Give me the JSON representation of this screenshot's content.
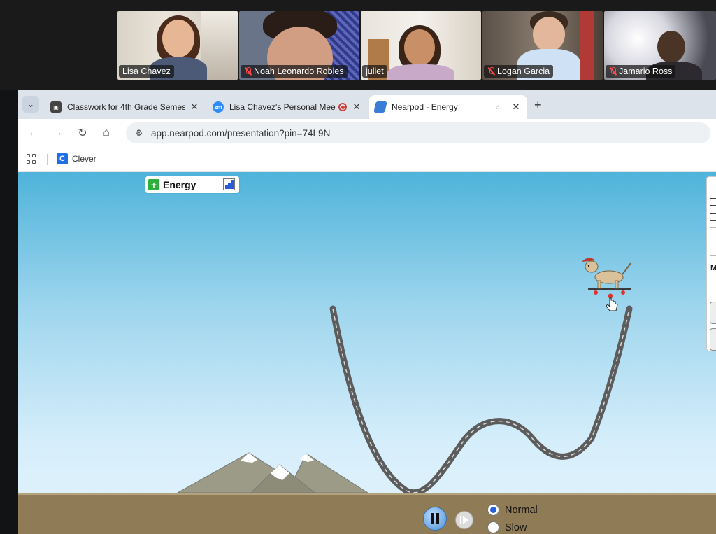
{
  "zoom": {
    "participants": [
      {
        "name": "Lisa Chavez",
        "muted": false,
        "active": false
      },
      {
        "name": "Noah Leonardo Robles",
        "muted": true,
        "active": false
      },
      {
        "name": "juliet",
        "muted": false,
        "active": true
      },
      {
        "name": "Logan Garcia",
        "muted": true,
        "active": false
      },
      {
        "name": "Jamario Ross",
        "muted": true,
        "active": false
      }
    ]
  },
  "browser": {
    "tabs": [
      {
        "title": "Classwork for 4th Grade Semes",
        "favicon": "classroom-icon"
      },
      {
        "title": "Lisa Chavez's Personal Mee",
        "favicon": "zoom-icon",
        "favicon_text": "zm"
      },
      {
        "title": "Nearpod - Energy",
        "favicon": "nearpod-icon"
      }
    ],
    "url": "app.nearpod.com/presentation?pin=74L9N",
    "bookmarks": [
      {
        "label": "Clever",
        "icon_text": "C"
      }
    ]
  },
  "sim": {
    "energy_label": "Energy",
    "speed_options": [
      {
        "label": "Normal",
        "selected": true
      },
      {
        "label": "Slow",
        "selected": false
      }
    ],
    "side_panel_letter": "M"
  },
  "colors": {
    "zoom_active_border": "#3fbf4f",
    "sky_top": "#4fb3da",
    "ground": "#8f7b55",
    "pause_button": "#4b8fd8",
    "radio_selected": "#2560d8"
  }
}
